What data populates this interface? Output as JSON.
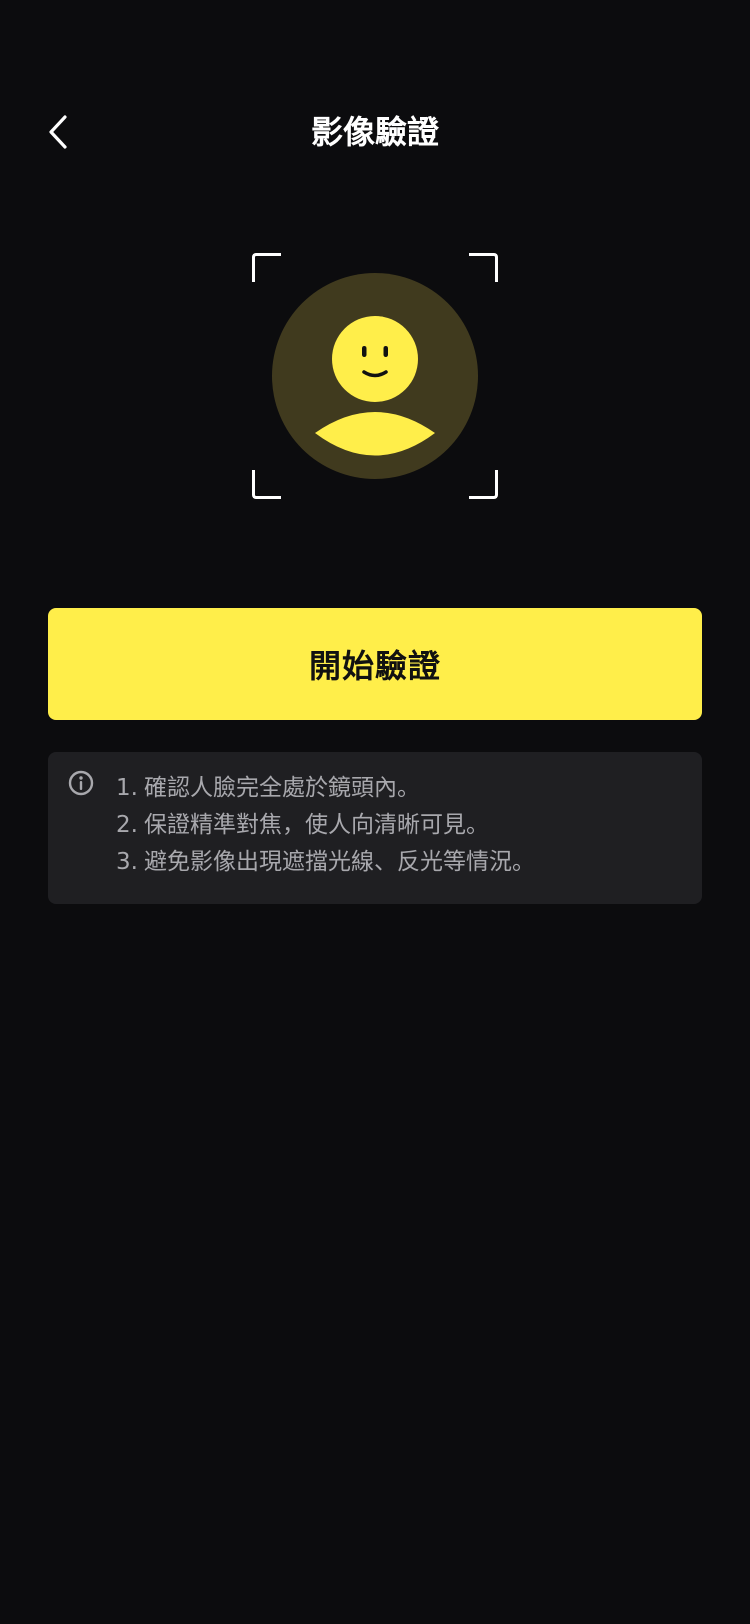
{
  "header": {
    "title": "影像驗證",
    "back_icon": "chevron-left-icon"
  },
  "illustration": {
    "icon": "face-avatar-icon",
    "frame": "scan-frame-corners",
    "colors": {
      "accent": "#ffee4a",
      "circle_bg": "#403a1e",
      "face_features": "#111111"
    }
  },
  "start_button": {
    "label": "開始驗證",
    "color": "#ffee4a"
  },
  "tips": {
    "icon": "info-circle-icon",
    "items": [
      {
        "num": "1.",
        "text": "確認人臉完全處於鏡頭內。"
      },
      {
        "num": "2.",
        "text": "保證精準對焦，使人向清晰可見。"
      },
      {
        "num": "3.",
        "text": "避免影像出現遮擋光線、反光等情況。"
      }
    ]
  }
}
